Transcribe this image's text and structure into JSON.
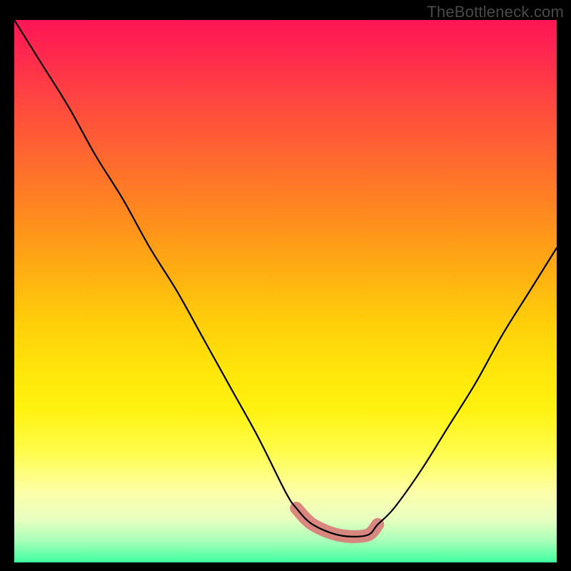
{
  "watermark": "TheBottleneck.com",
  "chart_data": {
    "type": "line",
    "title": "",
    "xlabel": "",
    "ylabel": "",
    "ylim": [
      0,
      100
    ],
    "series": [
      {
        "name": "curve",
        "x": [
          0,
          5,
          10,
          15,
          20,
          25,
          30,
          35,
          40,
          45,
          50,
          52,
          55,
          60,
          65,
          67,
          70,
          75,
          80,
          85,
          90,
          95,
          100
        ],
        "values": [
          100,
          92,
          84,
          75,
          67,
          58,
          50,
          41,
          32,
          23,
          13,
          10,
          7,
          5,
          5,
          7,
          10,
          17,
          25,
          33,
          42,
          50,
          58
        ]
      }
    ],
    "highlight_band": {
      "x_start": 52,
      "x_end": 67,
      "y_max": 10
    }
  },
  "colors": {
    "curve": "#000000",
    "band": "#d97a78"
  }
}
